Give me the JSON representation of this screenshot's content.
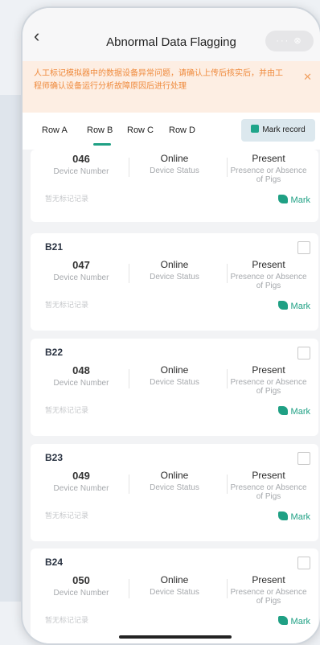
{
  "navbar": {
    "back_icon": "chevron-left-icon",
    "title": "Abnormal Data Flagging",
    "capsule": "··· ⊗"
  },
  "banner": {
    "text": "人工标记模拟器中的数据设备异常问题，请确认上传后核实后，并由工程师确认设备运行分析故障原因后进行处理",
    "close_icon": "close-icon"
  },
  "tabs": [
    {
      "label": "Row A",
      "active": false
    },
    {
      "label": "Row B",
      "active": true
    },
    {
      "label": "Row C",
      "active": false
    },
    {
      "label": "Row D",
      "active": false
    }
  ],
  "mark_record": {
    "label": "Mark record",
    "icon": "edit-icon"
  },
  "columns": {
    "device_number": "Device Number",
    "device_status": "Device Status",
    "presence": "Presence or Absence of Pigs"
  },
  "no_record": "暂无标记记录",
  "mark_label": "Mark",
  "cards": [
    {
      "label": "",
      "number": "046",
      "status": "Online",
      "presence": "Present"
    },
    {
      "label": "B21",
      "number": "047",
      "status": "Online",
      "presence": "Present"
    },
    {
      "label": "B22",
      "number": "048",
      "status": "Online",
      "presence": "Present"
    },
    {
      "label": "B23",
      "number": "049",
      "status": "Online",
      "presence": "Present"
    },
    {
      "label": "B24",
      "number": "050",
      "status": "Online",
      "presence": "Present"
    }
  ],
  "colors": {
    "accent": "#1fa084",
    "banner_text": "#ef8a3c",
    "banner_bg": "#fdeee3"
  }
}
